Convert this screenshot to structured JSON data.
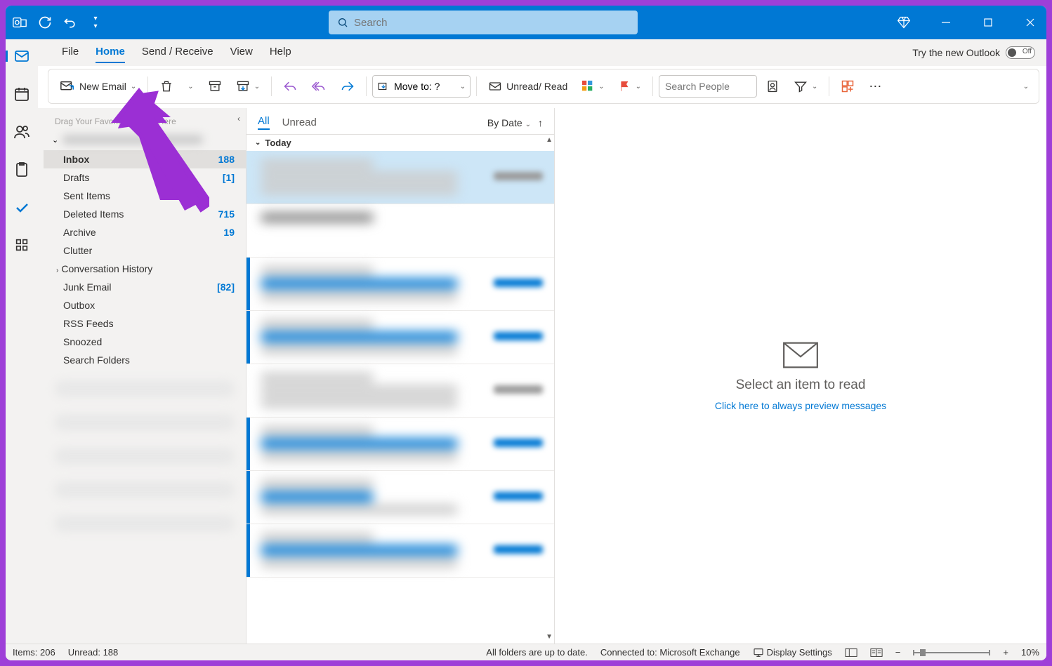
{
  "titlebar": {
    "search_placeholder": "Search"
  },
  "menu": {
    "tabs": [
      "File",
      "Home",
      "Send / Receive",
      "View",
      "Help"
    ],
    "active": "Home",
    "try_new": "Try the new Outlook",
    "toggle_state": "Off"
  },
  "ribbon": {
    "new_email": "New Email",
    "moveto_label": "Move to: ?",
    "unread_read": "Unread/ Read",
    "search_people_placeholder": "Search People"
  },
  "folders": {
    "fav_hint": "Drag Your Favorite Folders Here",
    "items": [
      {
        "name": "Inbox",
        "count": "188",
        "selected": true
      },
      {
        "name": "Drafts",
        "count": "[1]"
      },
      {
        "name": "Sent Items",
        "count": ""
      },
      {
        "name": "Deleted Items",
        "count": "715"
      },
      {
        "name": "Archive",
        "count": "19"
      },
      {
        "name": "Clutter",
        "count": ""
      },
      {
        "name": "Conversation History",
        "count": "",
        "chev": true
      },
      {
        "name": "Junk Email",
        "count": "[82]"
      },
      {
        "name": "Outbox",
        "count": ""
      },
      {
        "name": "RSS Feeds",
        "count": ""
      },
      {
        "name": "Snoozed",
        "count": ""
      },
      {
        "name": "Search Folders",
        "count": ""
      }
    ]
  },
  "msglist": {
    "filters": [
      "All",
      "Unread"
    ],
    "active_filter": "All",
    "sort_label": "By Date",
    "group_today": "Today"
  },
  "reading": {
    "title": "Select an item to read",
    "link": "Click here to always preview messages"
  },
  "status": {
    "items": "Items: 206",
    "unread": "Unread: 188",
    "sync": "All folders are up to date.",
    "conn": "Connected to: Microsoft Exchange",
    "display": "Display Settings",
    "zoom": "10%"
  }
}
